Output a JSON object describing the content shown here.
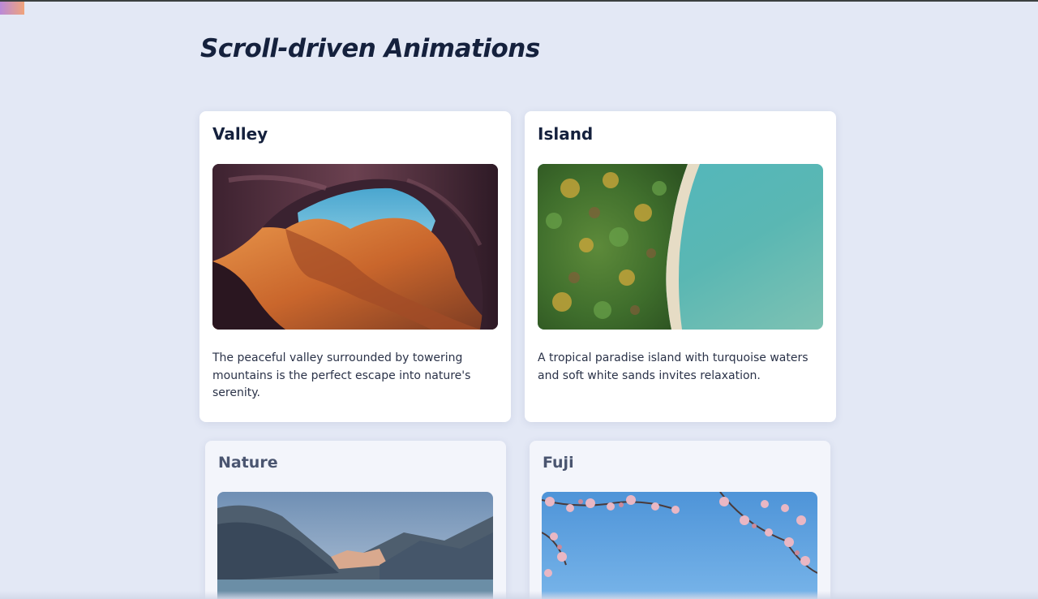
{
  "page": {
    "title": "Scroll-driven Animations",
    "accent_gradient": [
      "#b98ad9",
      "#f0a37a"
    ],
    "background": "#e3e8f5"
  },
  "cards": [
    {
      "title": "Valley",
      "image": "canyon-photo",
      "description": "The peaceful valley surrounded by towering mountains is the perfect escape into nature's serenity."
    },
    {
      "title": "Island",
      "image": "island-coast-photo",
      "description": "A tropical paradise island with turquoise waters and soft white sands invites relaxation."
    },
    {
      "title": "Nature",
      "image": "mountain-lake-photo",
      "description": ""
    },
    {
      "title": "Fuji",
      "image": "cherry-blossom-photo",
      "description": ""
    }
  ]
}
